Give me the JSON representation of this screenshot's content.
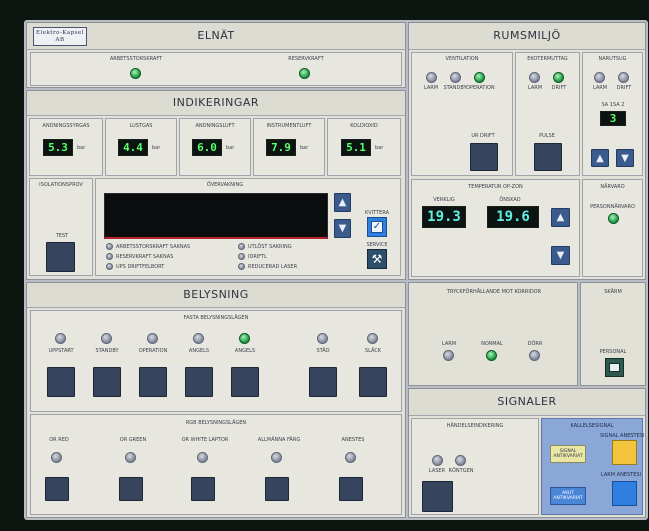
{
  "elnat": {
    "logo": "Elektro-Kapsel AB",
    "title": "ELNÄT",
    "items": [
      {
        "label": "ARBETSSTORSKRAFT",
        "state": "on"
      },
      {
        "label": "RESERVKRAFT",
        "state": "on"
      }
    ]
  },
  "rumsmiljo": {
    "title": "RUMSMILJÖ",
    "ventilation": {
      "title": "VENTILATION",
      "leds": [
        {
          "label": "LARM",
          "state": "off"
        },
        {
          "label": "STANDBY",
          "state": "off"
        },
        {
          "label": "OPERATION",
          "state": "on"
        }
      ],
      "button_label": "UR DRIFT"
    },
    "ekoter": {
      "title": "EKOTERMUTTAG",
      "leds": [
        {
          "label": "LARM",
          "state": "off"
        },
        {
          "label": "DRIFT",
          "state": "on"
        }
      ],
      "button_label": "PULSE"
    },
    "narutsug": {
      "title": "NARUTSUG",
      "leds": [
        {
          "label": "LARM",
          "state": "off"
        },
        {
          "label": "DRIFT",
          "state": "off"
        }
      ],
      "level_label": "SA 1SA 2",
      "level_value": "3"
    },
    "temperatur": {
      "title": "TEMPERATUR OP-ZON",
      "actual_label": "VERKLIG",
      "actual_value": "19.3",
      "target_label": "ÖNSKAD",
      "target_value": "19.6"
    },
    "narvaro": {
      "title": "NÄRVARO",
      "led_label": "PERSONNÄRVARO",
      "state": "on"
    },
    "tryck": {
      "title": "TRYCKFÖRHÅLLANDE MOT KORRIDOR",
      "leds": [
        {
          "label": "LARM",
          "state": "off"
        },
        {
          "label": "NORMAL",
          "state": "on"
        },
        {
          "label": "DÖRR",
          "state": "off"
        }
      ]
    },
    "skarm": {
      "title": "SKÄRM",
      "button_label": "PERSONAL"
    }
  },
  "indikeringar": {
    "title": "INDIKERINGAR",
    "gauges": [
      {
        "label": "ANDNINGSSYRGAS",
        "value": "5.3",
        "unit": "bar"
      },
      {
        "label": "LUSTGAS",
        "value": "4.4",
        "unit": "bar"
      },
      {
        "label": "ANDNINGSLUFT",
        "value": "6.0",
        "unit": "bar"
      },
      {
        "label": "INSTRUMENTLUFT",
        "value": "7.9",
        "unit": "bar"
      },
      {
        "label": "KOLDIOXID",
        "value": "5.1",
        "unit": "bar"
      }
    ],
    "isolation": {
      "title": "ISOLATIONSPROV",
      "button_label": "TEST"
    },
    "overvakning": {
      "title": "ÖVERVAKNING",
      "left_items": [
        "ARBETSSTORSKRAFT SAKNAS",
        "RESERVKRAFT SAKNAS",
        "UPS DRIFTFELBORT"
      ],
      "right_items": [
        "UTLÖST SAKRING",
        "IDRIFTL",
        "REDUCERAD LASER"
      ],
      "kvittera_label": "KVITTERA",
      "service_label": "SERVICE"
    }
  },
  "belysning": {
    "title": "BELYSNING",
    "fasta": {
      "title": "FASTA BELYSNINGSLÄGEN",
      "items": [
        {
          "label": "UPPSTART",
          "state": "off"
        },
        {
          "label": "STANDBY",
          "state": "off"
        },
        {
          "label": "OPERATION",
          "state": "off"
        },
        {
          "label": "ANGELS",
          "state": "off"
        },
        {
          "label": "ANGELS",
          "state": "on"
        },
        {
          "label": "STÄD",
          "state": "off"
        },
        {
          "label": "SLÄCK",
          "state": "off"
        }
      ]
    },
    "rgb": {
      "title": "RGB BELYSNINGSLÄGEN",
      "items": [
        {
          "label": "OR RED",
          "state": "off"
        },
        {
          "label": "OR GREEN",
          "state": "off"
        },
        {
          "label": "OR WHITE LAPTOR",
          "state": "off"
        },
        {
          "label": "ALLMÄNNA FÄRG",
          "state": "off"
        },
        {
          "label": "ANESTES",
          "state": "off"
        }
      ]
    }
  },
  "signaler": {
    "title": "SIGNALER",
    "handelse": {
      "title": "HÄNDELSEINDIKERING",
      "leds": [
        {
          "label": "LASER",
          "state": "off"
        },
        {
          "label": "RÖNTGEN",
          "state": "off"
        }
      ]
    },
    "kallelse": {
      "title": "KALLELSESIGNAL",
      "signal_top_label": "SIGNAL ANESTESI",
      "tag_top": "SIGNAL ANTIKVARIAT",
      "signal_bottom_label": "LARM ANESTESI",
      "tag_bottom": "AKUT ANTIKVARIAT"
    }
  },
  "colors": {
    "panel": "#b9bdc5",
    "section": "#e2e1d8",
    "led_on": "#1d9a45",
    "led_off": "#8a92a2",
    "button": "#36445e",
    "lcd_green": "#56ff6a",
    "lcd_cyan": "#5ff0e4",
    "signal_yellow": "#f2c53d",
    "signal_blue": "#2f7fe0"
  }
}
